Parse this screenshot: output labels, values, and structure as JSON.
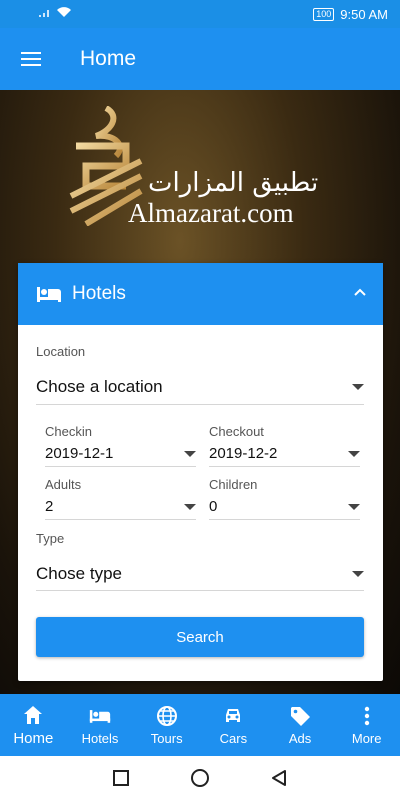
{
  "status_bar": {
    "battery": "100",
    "time": "9:50 AM"
  },
  "app_bar": {
    "title": "Home"
  },
  "logo": {
    "arabic": "تطبيق المزارات",
    "latin": "Almazarat.com"
  },
  "hotels_card": {
    "title": "Hotels",
    "location": {
      "label": "Location",
      "value": "Chose a location"
    },
    "checkin": {
      "label": "Checkin",
      "value": "2019-12-1"
    },
    "checkout": {
      "label": "Checkout",
      "value": "2019-12-2"
    },
    "adults": {
      "label": "Adults",
      "value": "2"
    },
    "children": {
      "label": "Children",
      "value": "0"
    },
    "type": {
      "label": "Type",
      "value": "Chose type"
    },
    "search_label": "Search"
  },
  "bottom_nav": {
    "items": [
      {
        "label": "Home",
        "icon": "home-icon",
        "active": true
      },
      {
        "label": "Hotels",
        "icon": "bed-icon"
      },
      {
        "label": "Tours",
        "icon": "globe-icon"
      },
      {
        "label": "Cars",
        "icon": "car-icon"
      },
      {
        "label": "Ads",
        "icon": "tag-icon"
      },
      {
        "label": "More",
        "icon": "more-vertical-icon"
      }
    ]
  },
  "colors": {
    "primary": "#1e90f0",
    "status_bar": "#1b8fe6"
  }
}
